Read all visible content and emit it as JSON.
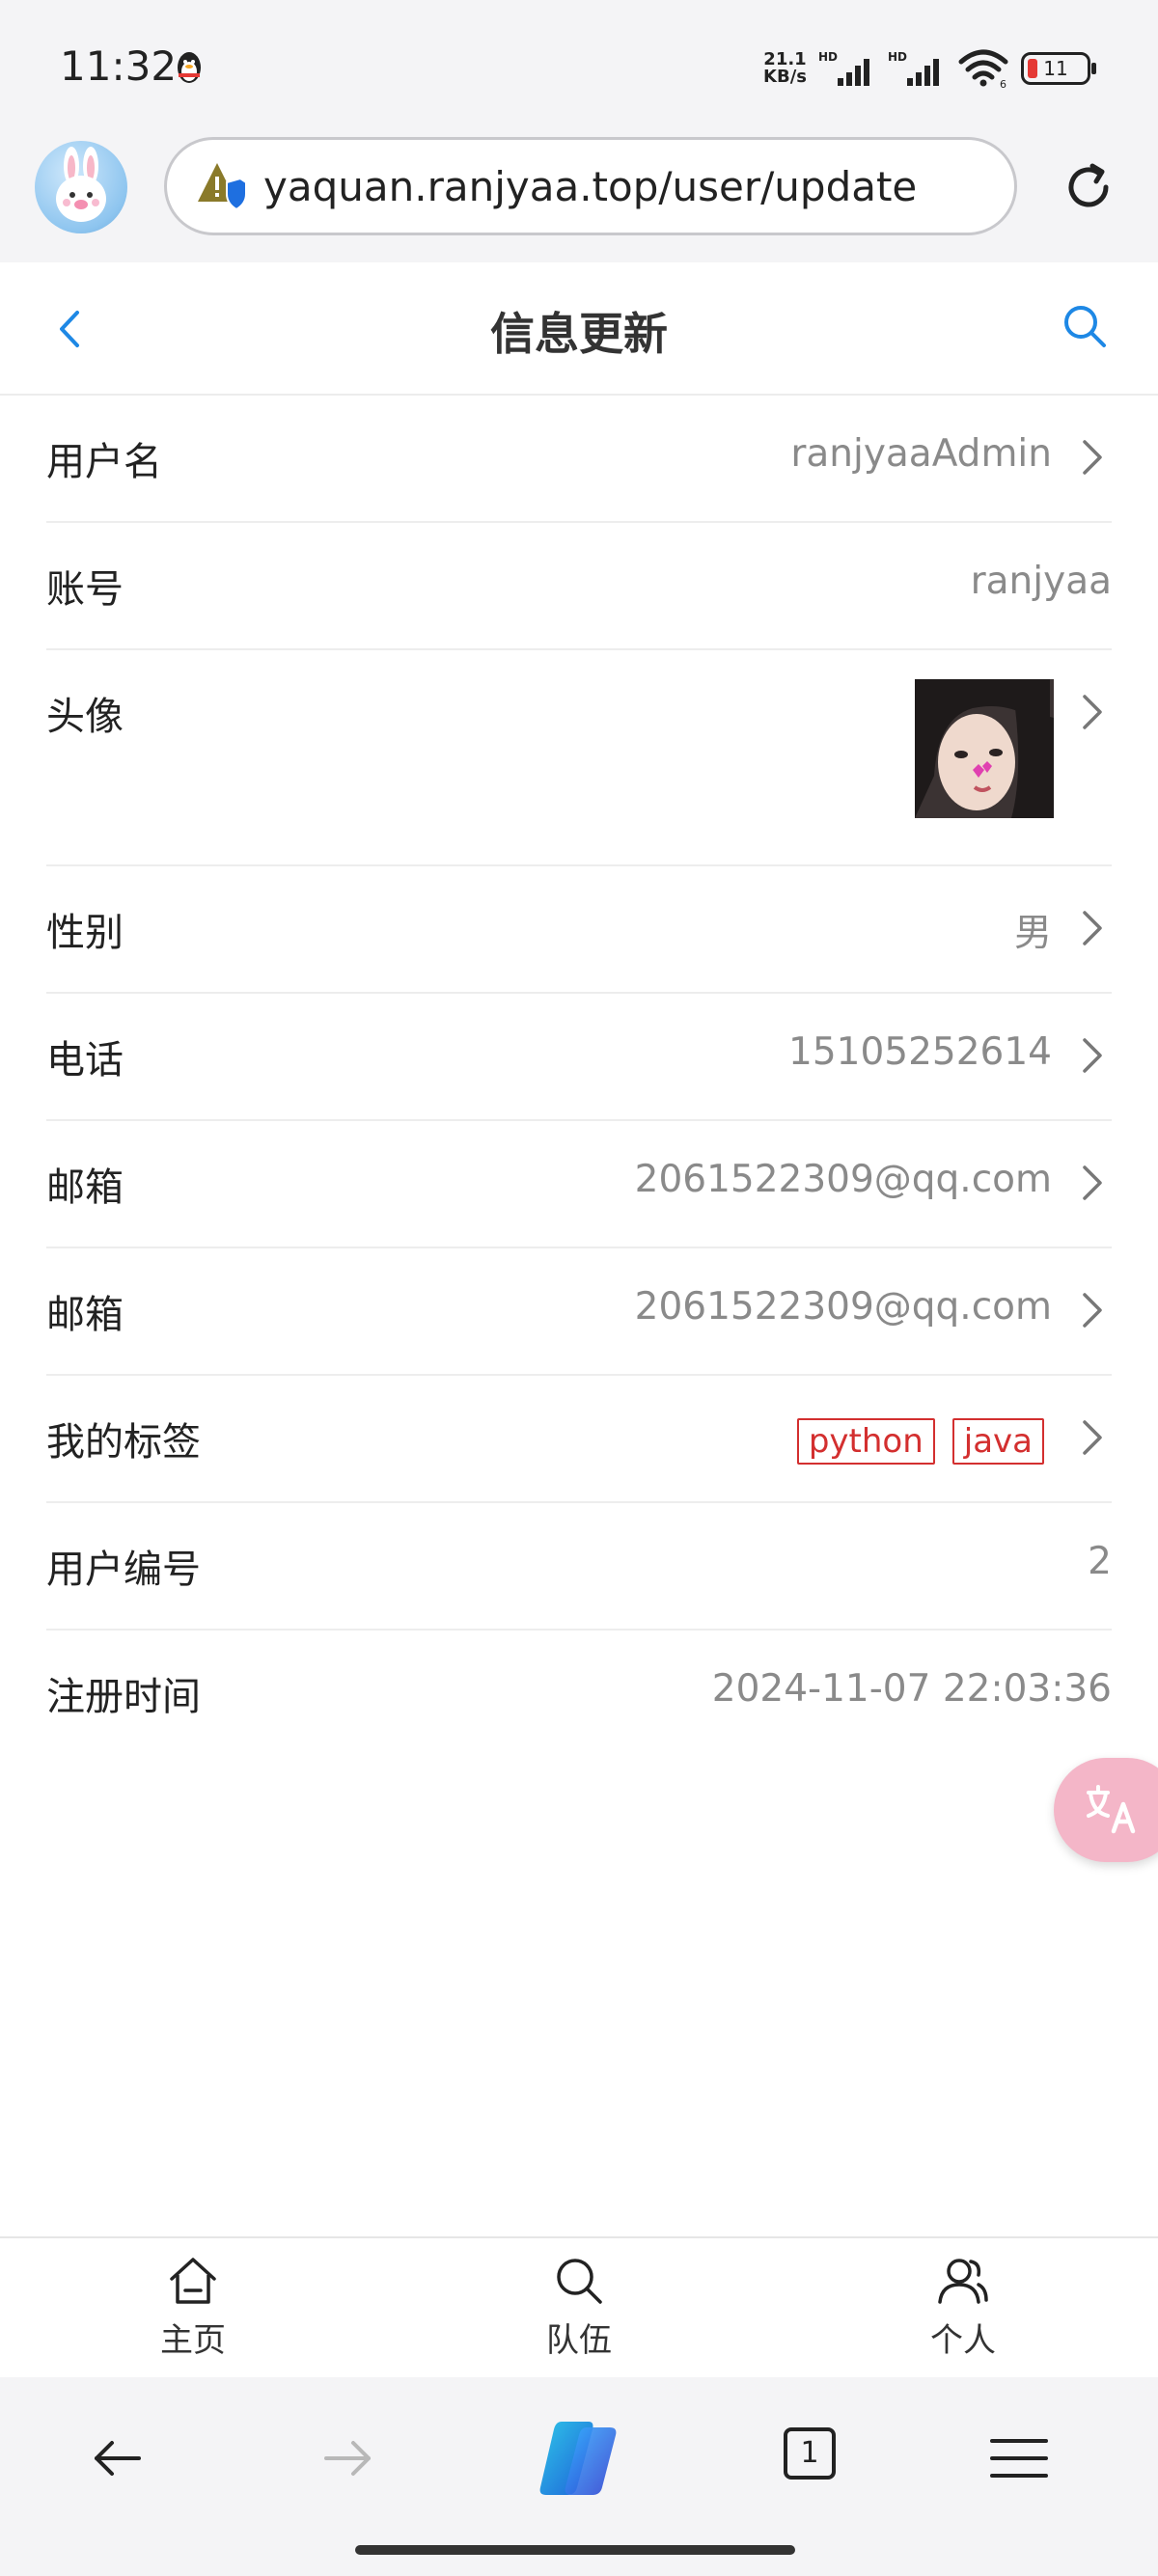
{
  "status_bar": {
    "time": "11:32",
    "net_speed_value": "21.1",
    "net_speed_unit": "KB/s",
    "sim1_label": "HD",
    "sim2_label": "HD",
    "wifi_sub": "6",
    "battery_level": "11"
  },
  "browser": {
    "url": "yaquan.ranjyaa.top/user/update"
  },
  "header": {
    "title": "信息更新"
  },
  "fields": [
    {
      "label": "用户名",
      "value": "ranjyaaAdmin"
    },
    {
      "label": "账号",
      "value": "ranjyaa"
    },
    {
      "label": "头像",
      "value": ""
    },
    {
      "label": "性别",
      "value": "男"
    },
    {
      "label": "电话",
      "value": "15105252614"
    },
    {
      "label": "邮箱",
      "value": "2061522309@qq.com"
    },
    {
      "label": "邮箱",
      "value": "2061522309@qq.com"
    },
    {
      "label": "我的标签",
      "tags": [
        "python",
        "java"
      ]
    },
    {
      "label": "用户编号",
      "value": "2"
    },
    {
      "label": "注册时间",
      "value": "2024-11-07 22:03:36"
    }
  ],
  "translate_fab": {
    "icon": "translate-icon"
  },
  "tabbar": {
    "items": [
      {
        "label": "主页",
        "icon": "home-icon"
      },
      {
        "label": "队伍",
        "icon": "search-icon"
      },
      {
        "label": "个人",
        "icon": "user-icon"
      }
    ]
  },
  "browser_nav": {
    "tab_count": "1"
  },
  "colors": {
    "accent": "#1e88e5",
    "tag": "#d32f2f",
    "fab": "#f4b6c8"
  }
}
